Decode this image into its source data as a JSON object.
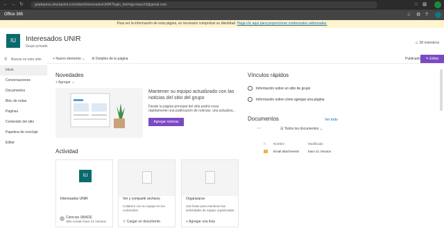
{
  "browser": {
    "url": "gradepesu.sharepoint.com/sites/InteresadosUNIR?login_hint=jgcompo19@gmail.com"
  },
  "suite": {
    "app_title": "Office 365",
    "icons": [
      "bell-icon",
      "gear-icon",
      "help-icon"
    ]
  },
  "notice": {
    "text": "Para ver la información de esta página, es necesario comprobar su identidad.",
    "link": "Haga clic aquí para proporcionar credenciales adicionales."
  },
  "site": {
    "logo_text": "IU",
    "title": "Interesados UNIR",
    "subtitle": "Grupo privado",
    "members": "38 miembros"
  },
  "search": {
    "placeholder": "Buscar en este sitio"
  },
  "nav": {
    "items": [
      {
        "label": "Inicio",
        "selected": true
      },
      {
        "label": "Conversaciones"
      },
      {
        "label": "Documentos"
      },
      {
        "label": "Bloc de notas"
      },
      {
        "label": "Páginas"
      },
      {
        "label": "Contenido del sitio"
      },
      {
        "label": "Papelera de reciclaje"
      },
      {
        "label": "Editar"
      }
    ]
  },
  "commands": {
    "new_item": "Nuevo elemento",
    "page_details": "Detalles de la página",
    "published": "Publicado",
    "edit": "Editar"
  },
  "news": {
    "heading": "Novedades",
    "add": "Agregar",
    "title": "Mantener su equipo actualizado con las noticias del sitio del grupo",
    "body": "Desde la página principal del sitio podrá crear rápidamente una publicación de noticias: una actualiza...",
    "button": "Agregar noticias"
  },
  "activity": {
    "heading": "Actividad",
    "cards": [
      {
        "title": "Interesados UNIR",
        "text": "",
        "action": "Ciencias UBADE",
        "meta": "Sitio creado hace 21 minutos"
      },
      {
        "title": "Ver y compartir archivos",
        "text": "Colabore con su equipo en los contenidos.",
        "action": "Cargar un documento"
      },
      {
        "title": "Organizarse",
        "text": "Use listas para mantener las actividades de equipo organizadas.",
        "action": "Agregar una lista"
      }
    ]
  },
  "quick_links": {
    "heading": "Vínculos rápidos",
    "items": [
      "Información sobre un sitio de grupo",
      "Información sobre cómo agregar una página"
    ]
  },
  "documents": {
    "heading": "Documentos",
    "see_all": "Ver todo",
    "filter": "Todos los documentos",
    "col_name": "Nombre",
    "col_modified": "Modificado",
    "rows": [
      {
        "name": "Email attachments",
        "modified": "hace 21 minutos"
      }
    ]
  },
  "colors": {
    "accent": "#7b49c4",
    "brand": "#0b6a6b",
    "suite_bar": "#444444"
  }
}
